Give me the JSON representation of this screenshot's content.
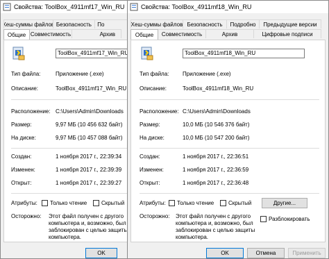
{
  "back_window": {
    "title": "Свойства: ToolBox_4911mf17_Win_RU",
    "tabs_row1": [
      "Хеш-суммы файлов",
      "Безопасность",
      "По"
    ],
    "tabs_row2": [
      "Общие",
      "Совместимость",
      "Архив"
    ],
    "file_name": "ToolBox_4911mf17_Win_RU",
    "type_label": "Тип файла:",
    "type_value": "Приложение (.exe)",
    "desc_label": "Описание:",
    "desc_value": "ToolBox_4911mf17_Win_RU",
    "location_label": "Расположение:",
    "location_value": "C:\\Users\\Admin\\Downloads",
    "size_label": "Размер:",
    "size_value": "9,97 МБ (10 456 632 байт)",
    "disk_label": "На диске:",
    "disk_value": "9,97 МБ (10 457 088 байт)",
    "created_label": "Создан:",
    "created_value": "1 ноября 2017 г., 22:39:34",
    "modified_label": "Изменен:",
    "modified_value": "1 ноября 2017 г., 22:39:39",
    "opened_label": "Открыт:",
    "opened_value": "1 ноября 2017 г., 22:39:27",
    "attrs_label": "Атрибуты:",
    "readonly_label": "Только чтение",
    "hidden_label": "Скрытый",
    "caution_label": "Осторожно:",
    "caution_text": "Этот файл получен с другого компьютера и, возможно, был заблокирован с целью защиты компьютера.",
    "ok_label": "OK"
  },
  "front_window": {
    "title": "Свойства: ToolBox_4911mf18_Win_RU",
    "tabs_row1": [
      "Хеш-суммы файлов",
      "Безопасность",
      "Подробно",
      "Предыдущие версии"
    ],
    "tabs_row2": [
      "Общие",
      "Совместимость",
      "Архив",
      "Цифровые подписи"
    ],
    "file_name": "ToolBox_4911mf18_Win_RU",
    "type_label": "Тип файла:",
    "type_value": "Приложение (.exe)",
    "desc_label": "Описание:",
    "desc_value": "ToolBox_4911mf18_Win_RU",
    "location_label": "Расположение:",
    "location_value": "C:\\Users\\Admin\\Downloads",
    "size_label": "Размер:",
    "size_value": "10,0 МБ (10 546 376 байт)",
    "disk_label": "На диске:",
    "disk_value": "10,0 МБ (10 547 200 байт)",
    "created_label": "Создан:",
    "created_value": "1 ноября 2017 г., 22:36:51",
    "modified_label": "Изменен:",
    "modified_value": "1 ноября 2017 г., 22:36:59",
    "opened_label": "Открыт:",
    "opened_value": "1 ноября 2017 г., 22:36:48",
    "attrs_label": "Атрибуты:",
    "readonly_label": "Только чтение",
    "hidden_label": "Скрытый",
    "other_label": "Другие...",
    "caution_label": "Осторожно:",
    "caution_text": "Этот файл получен с другого компьютера и, возможно, был заблокирован с целью защиты компьютера.",
    "unblock_label": "Разблокировать",
    "ok_label": "OK",
    "cancel_label": "Отмена",
    "apply_label": "Применить"
  },
  "icons": {
    "window_icon": "file-properties-icon",
    "file_icon": "installer-file-icon"
  },
  "colors": {
    "accent": "#0078d7",
    "window_bg": "#f0f0f0",
    "panel_bg": "#ffffff"
  }
}
